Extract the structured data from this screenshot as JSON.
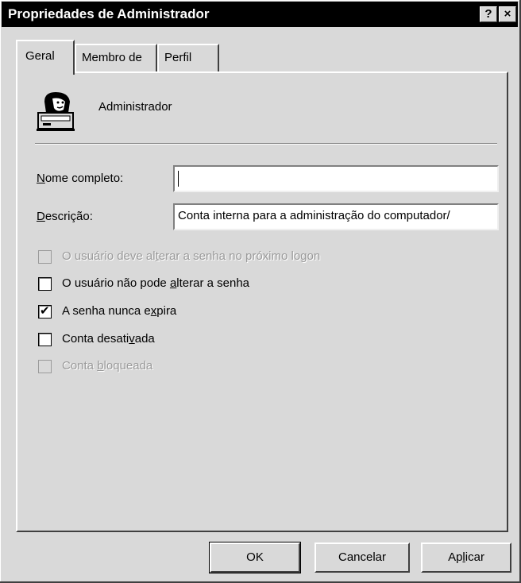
{
  "window": {
    "title": "Propriedades de Administrador",
    "help_button": "?",
    "close_button": "×"
  },
  "tabs": [
    {
      "label": "Geral",
      "active": true
    },
    {
      "label": "Membro de",
      "active": false
    },
    {
      "label": "Perfil",
      "active": false
    }
  ],
  "user": {
    "icon": "user-computer-icon",
    "name": "Administrador"
  },
  "fields": {
    "full_name": {
      "label_hotkey": "N",
      "label_rest": "ome completo:",
      "value": ""
    },
    "description": {
      "label_hotkey": "D",
      "label_rest": "escrição:",
      "value": "Conta interna para a administração do computador/"
    }
  },
  "checkboxes": [
    {
      "pre": "O usuário deve al",
      "hotkey": "t",
      "post": "erar a senha no próximo logon",
      "checked": false,
      "enabled": false
    },
    {
      "pre": "O usuário não pode ",
      "hotkey": "a",
      "post": "lterar a senha",
      "checked": false,
      "enabled": true
    },
    {
      "pre": "A senha nunca e",
      "hotkey": "x",
      "post": "pira",
      "checked": true,
      "enabled": true
    },
    {
      "pre": "Conta desati",
      "hotkey": "v",
      "post": "ada",
      "checked": false,
      "enabled": true
    },
    {
      "pre": "Conta ",
      "hotkey": "b",
      "post": "loqueada",
      "checked": false,
      "enabled": false
    }
  ],
  "checkmark": "✔",
  "buttons": {
    "ok": "OK",
    "cancel": "Cancelar",
    "apply_pre": "Ap",
    "apply_hotkey": "l",
    "apply_post": "icar"
  }
}
